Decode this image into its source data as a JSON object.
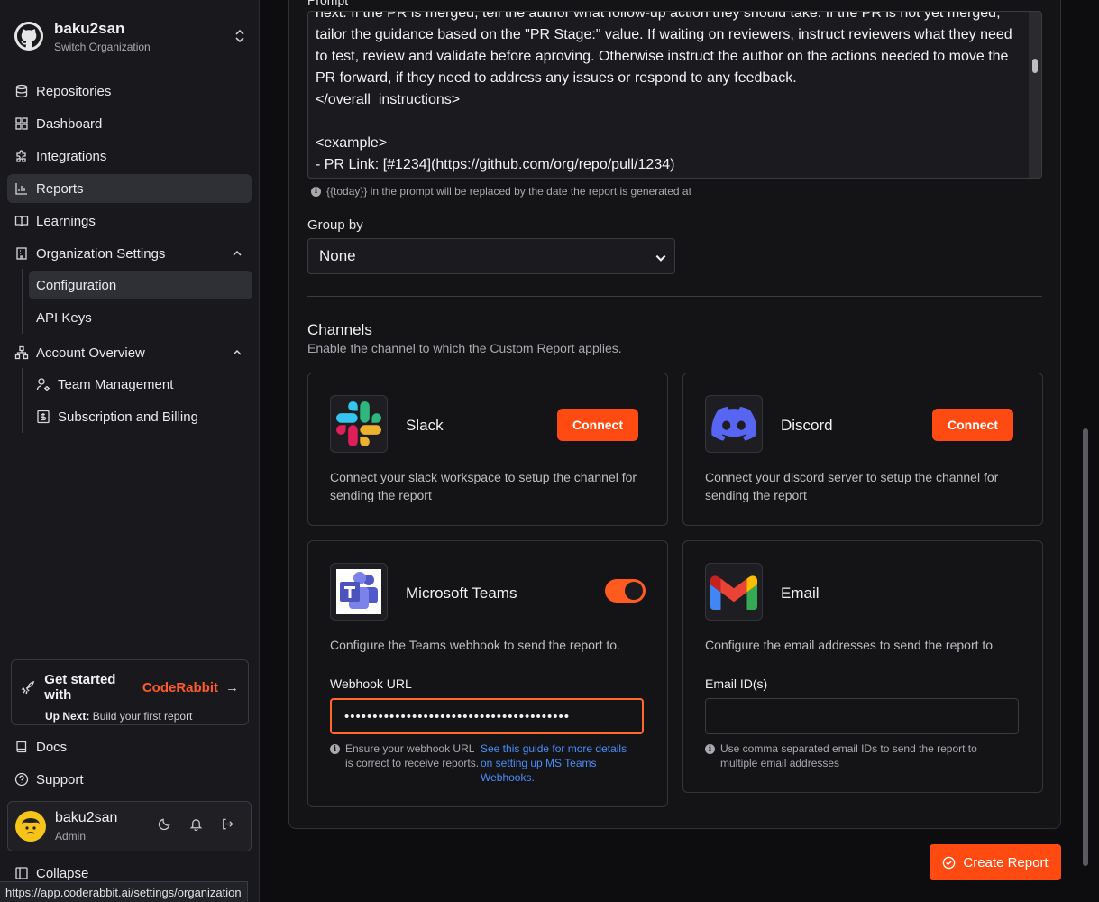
{
  "org": {
    "name": "baku2san",
    "switch_label": "Switch Organization"
  },
  "nav": {
    "repositories": "Repositories",
    "dashboard": "Dashboard",
    "integrations": "Integrations",
    "reports": "Reports",
    "learnings": "Learnings",
    "org_settings": "Organization Settings",
    "configuration": "Configuration",
    "api_keys": "API Keys",
    "account_overview": "Account Overview",
    "team_management": "Team Management",
    "subscription": "Subscription and Billing"
  },
  "promo": {
    "title": "Get started with",
    "brand": "CodeRabbit",
    "next_label": "Up Next:",
    "next_value": "Build your first report"
  },
  "footer_nav": {
    "docs": "Docs",
    "support": "Support",
    "collapse": "Collapse"
  },
  "user": {
    "name": "baku2san",
    "role": "Admin"
  },
  "status_url": "https://app.coderabbit.ai/settings/organization",
  "prompt": {
    "label": "Prompt",
    "text": "next. If the PR is merged, tell the author what follow-up action they should take. If the PR is not yet merged, tailor the guidance based on the \"PR Stage:\" value. If waiting on reviewers, instruct reviewers what they need to test, review and validate before aproving. Otherwise instruct the author on the actions needed to move the PR forward, if they need to address any issues or respond to any feedback.\n</overall_instructions>\n\n<example>\n- PR Link: [#1234](https://github.com/org/repo/pull/1234)",
    "note": "{{today}} in the prompt will be replaced by the date the report is generated at"
  },
  "group_by": {
    "label": "Group by",
    "value": "None"
  },
  "channels": {
    "title": "Channels",
    "subtitle": "Enable the channel to which the Custom Report applies.",
    "slack": {
      "name": "Slack",
      "button": "Connect",
      "desc": "Connect your slack workspace to setup the channel for sending the report"
    },
    "discord": {
      "name": "Discord",
      "button": "Connect",
      "desc": "Connect your discord server to setup the channel for sending the report"
    },
    "teams": {
      "name": "Microsoft Teams",
      "enabled": true,
      "desc": "Configure the Teams webhook to send the report to.",
      "field_label": "Webhook URL",
      "value": "••••••••••••••••••••••••••••••••••••••••",
      "help": "Ensure your webhook URL is correct to receive reports.",
      "help_link": "See this guide for more details on setting up MS Teams Webhooks."
    },
    "email": {
      "name": "Email",
      "desc": "Configure the email addresses to send the report to",
      "field_label": "Email ID(s)",
      "value": "",
      "help": "Use comma separated email IDs to send the report to multiple email addresses"
    }
  },
  "create_button": "Create Report",
  "colors": {
    "accent": "#ff4b12",
    "background": "#0d0d0f",
    "sidebar": "#19191d",
    "link": "#4a8df8"
  }
}
